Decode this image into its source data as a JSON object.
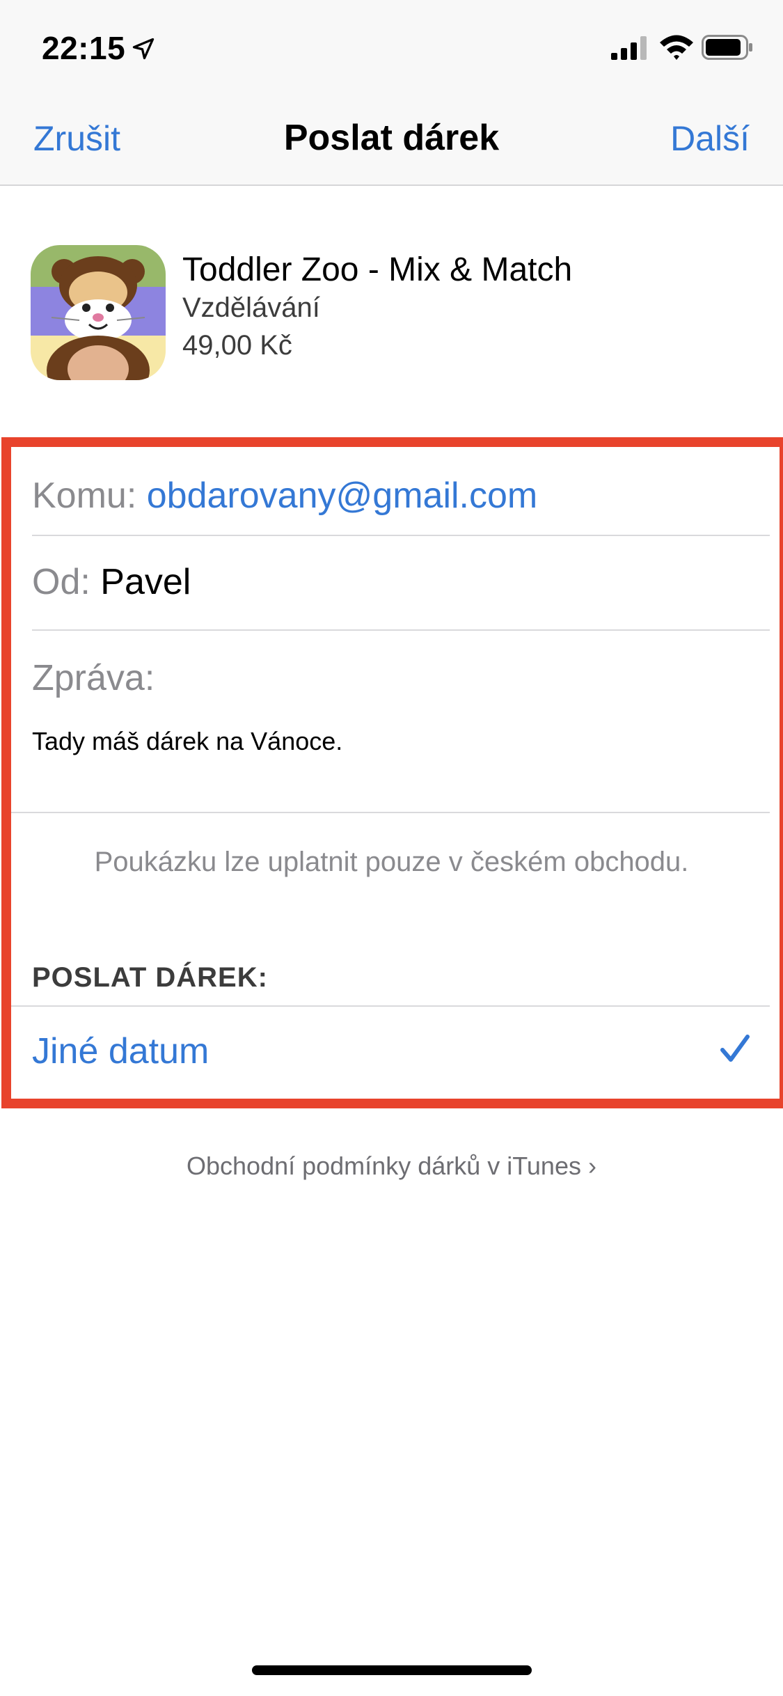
{
  "status_bar": {
    "time": "22:15",
    "icons": [
      "location-arrow-icon",
      "cellular-signal-icon",
      "wifi-icon",
      "battery-icon"
    ]
  },
  "nav": {
    "cancel_label": "Zrušit",
    "title": "Poslat dárek",
    "next_label": "Další"
  },
  "app": {
    "name": "Toddler Zoo - Mix & Match",
    "category": "Vzdělávání",
    "price": "49,00 Kč"
  },
  "form": {
    "to_label": "Komu:",
    "to_value": "obdarovany@gmail.com",
    "from_label": "Od:",
    "from_value": "Pavel",
    "message_label": "Zpráva:",
    "message_value": "Tady máš dárek na Vánoce.",
    "note": "Poukázku lze uplatnit pouze v českém obchodu."
  },
  "send_section": {
    "header": "POSLAT DÁREK:",
    "option_label": "Jiné datum",
    "option_checked": true
  },
  "footer": {
    "terms_link": "Obchodní podmínky dárků v iTunes"
  },
  "colors": {
    "accent": "#3478d5",
    "highlight_border": "#e8432c",
    "secondary_text": "#8a8a8e"
  }
}
